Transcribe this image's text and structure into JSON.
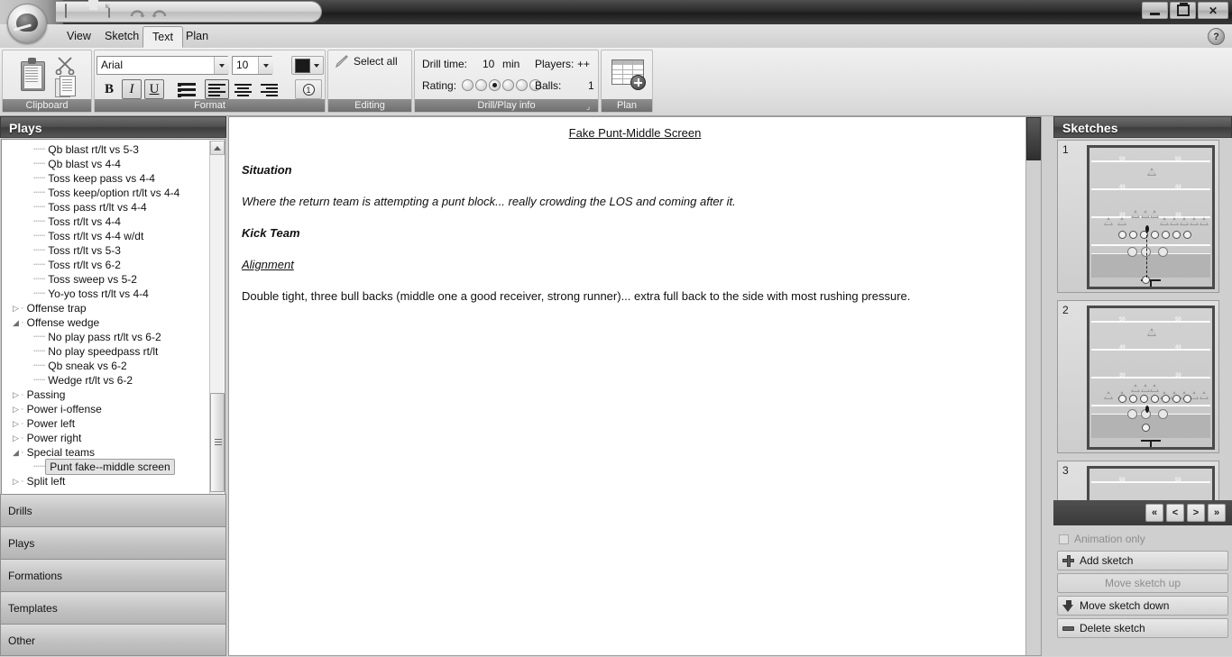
{
  "titlebar": {
    "quick_access": [
      {
        "name": "app-icon",
        "label": ""
      },
      {
        "name": "save-icon",
        "label": ""
      },
      {
        "name": "new-icon",
        "label": ""
      },
      {
        "name": "undo-icon",
        "label": ""
      },
      {
        "name": "redo-icon",
        "label": ""
      }
    ],
    "minimize": "",
    "restore": "",
    "close": "✕"
  },
  "tabs": [
    {
      "label": "View",
      "active": false
    },
    {
      "label": "Sketch",
      "active": false
    },
    {
      "label": "Text",
      "active": true
    },
    {
      "label": "Plan",
      "active": false
    }
  ],
  "help_label": "?",
  "ribbon": {
    "clipboard": {
      "title": "Clipboard",
      "paste_icon": "paste-icon",
      "cut_icon": "scissors-icon",
      "copy_icon": "copy-icon"
    },
    "format": {
      "title": "Format",
      "font_family": "Arial",
      "font_size": "10",
      "color_hex": "#1a1a1a",
      "bold": "B",
      "italic": "I",
      "underline": "U",
      "numbering": "1"
    },
    "editing": {
      "title": "Editing",
      "select_all": "Select all"
    },
    "drill_info": {
      "title": "Drill/Play info",
      "drill_time_label": "Drill time:",
      "drill_time_value": "10",
      "drill_time_unit": "min",
      "players_label": "Players:",
      "players_value": "++",
      "rating_label": "Rating:",
      "rating_total": 6,
      "rating_value": 3,
      "balls_label": "Balls:",
      "balls_value": "1"
    },
    "plan": {
      "title": "Plan",
      "icon": "add-plan-icon"
    }
  },
  "left_panel": {
    "header": "Plays",
    "tree": [
      {
        "label": "Qb blast rt/lt vs 5-3",
        "level": 2,
        "type": "leaf"
      },
      {
        "label": "Qb blast vs 4-4",
        "level": 2,
        "type": "leaf"
      },
      {
        "label": "Toss keep pass vs 4-4",
        "level": 2,
        "type": "leaf"
      },
      {
        "label": "Toss keep/option rt/lt vs 4-4",
        "level": 2,
        "type": "leaf"
      },
      {
        "label": "Toss pass rt/lt vs 4-4",
        "level": 2,
        "type": "leaf"
      },
      {
        "label": "Toss rt/lt vs 4-4",
        "level": 2,
        "type": "leaf"
      },
      {
        "label": "Toss rt/lt vs 4-4 w/dt",
        "level": 2,
        "type": "leaf"
      },
      {
        "label": "Toss rt/lt vs 5-3",
        "level": 2,
        "type": "leaf"
      },
      {
        "label": "Toss rt/lt vs 6-2",
        "level": 2,
        "type": "leaf"
      },
      {
        "label": "Toss sweep vs 5-2",
        "level": 2,
        "type": "leaf"
      },
      {
        "label": "Yo-yo toss rt/lt vs 4-4",
        "level": 2,
        "type": "leaf"
      },
      {
        "label": "Offense trap",
        "level": 1,
        "type": "collapsed"
      },
      {
        "label": "Offense wedge",
        "level": 1,
        "type": "expanded"
      },
      {
        "label": "No play pass rt/lt vs 6-2",
        "level": 2,
        "type": "leaf"
      },
      {
        "label": "No play speedpass rt/lt",
        "level": 2,
        "type": "leaf"
      },
      {
        "label": "Qb sneak vs 6-2",
        "level": 2,
        "type": "leaf"
      },
      {
        "label": "Wedge rt/lt vs 6-2",
        "level": 2,
        "type": "leaf"
      },
      {
        "label": "Passing",
        "level": 1,
        "type": "collapsed"
      },
      {
        "label": "Power i-offense",
        "level": 1,
        "type": "collapsed"
      },
      {
        "label": "Power left",
        "level": 1,
        "type": "collapsed"
      },
      {
        "label": "Power right",
        "level": 1,
        "type": "collapsed"
      },
      {
        "label": "Special teams",
        "level": 1,
        "type": "expanded"
      },
      {
        "label": "Punt fake--middle screen",
        "level": 2,
        "type": "leaf",
        "selected": true
      },
      {
        "label": "Split left",
        "level": 1,
        "type": "collapsed"
      }
    ],
    "buttons": [
      {
        "label": "Drills"
      },
      {
        "label": "Plays"
      },
      {
        "label": "Formations"
      },
      {
        "label": "Templates"
      },
      {
        "label": "Other"
      }
    ]
  },
  "document": {
    "title": "Fake Punt-Middle Screen",
    "blocks": [
      {
        "kind": "heading",
        "text": "Situation"
      },
      {
        "kind": "italic",
        "text": "Where the return team is attempting a punt block... really crowding the LOS and coming after it."
      },
      {
        "kind": "heading",
        "text": "Kick Team"
      },
      {
        "kind": "underline",
        "text": "Alignment"
      },
      {
        "kind": "paragraph",
        "text": "Double tight, three bull backs (middle one a good receiver, strong runner)... extra full back to the side with most rushing pressure."
      }
    ]
  },
  "right_panel": {
    "header": "Sketches",
    "sketches": [
      {
        "number": "1",
        "yard_labels": [
          "50",
          "50",
          "40",
          "40",
          "30",
          "30",
          "10",
          "10"
        ]
      },
      {
        "number": "2",
        "yard_labels": [
          "50",
          "50",
          "40",
          "40",
          "30",
          "30",
          "10",
          "10"
        ]
      },
      {
        "number": "3",
        "yard_labels": [
          "50",
          "50"
        ]
      }
    ],
    "nav": [
      {
        "label": "«",
        "name": "first-sketch-button"
      },
      {
        "label": "<",
        "name": "prev-sketch-button"
      },
      {
        "label": ">",
        "name": "next-sketch-button"
      },
      {
        "label": "»",
        "name": "last-sketch-button"
      }
    ],
    "animation_only_label": "Animation only",
    "tools": [
      {
        "label": "Add sketch",
        "icon": "plus-icon",
        "disabled": false
      },
      {
        "label": "Move sketch up",
        "icon": "",
        "disabled": true
      },
      {
        "label": "Move sketch down",
        "icon": "arrow-down-icon",
        "disabled": false
      },
      {
        "label": "Delete sketch",
        "icon": "minus-icon",
        "disabled": false
      }
    ]
  }
}
